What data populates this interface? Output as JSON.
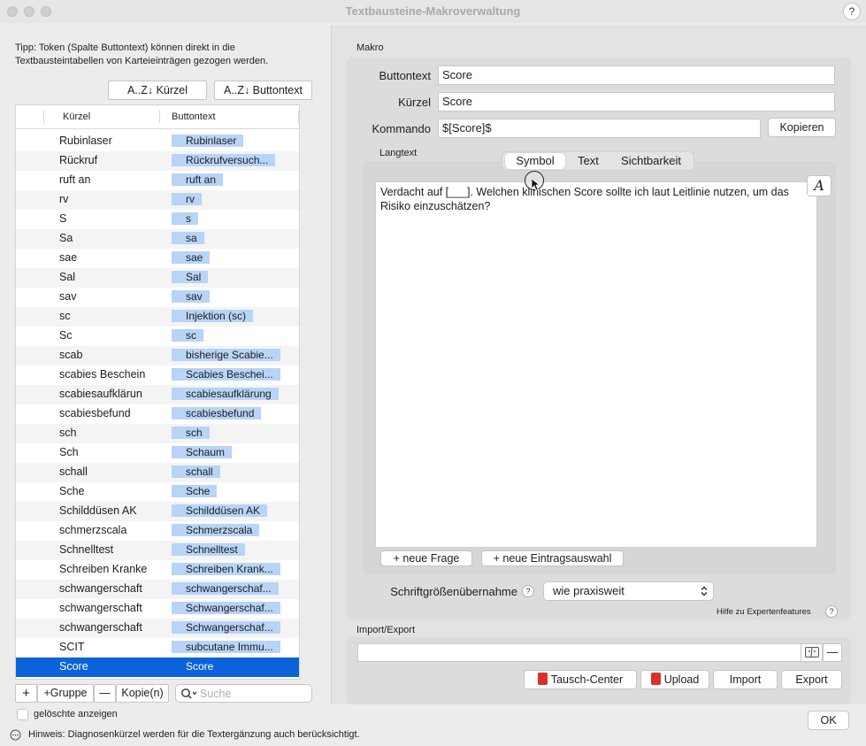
{
  "window": {
    "title": "Textbausteine-Makroverwaltung",
    "help": "?"
  },
  "left": {
    "tip": "Tipp: Token (Spalte Buttontext) können direkt in die Textbausteintabellen von Karteieinträgen gezogen werden.",
    "sort_kuerzel": "A..Z↓ Kürzel",
    "sort_buttontext": "A..Z↓ Buttontext",
    "table": {
      "col_kuerzel": "Kürzel",
      "col_buttontext": "Buttontext",
      "rows": [
        {
          "k": "Rubinlaser",
          "b": "Rubinlaser"
        },
        {
          "k": "Rückruf",
          "b": "Rückrufversuch..."
        },
        {
          "k": "ruft an",
          "b": "ruft an"
        },
        {
          "k": "rv",
          "b": "rv"
        },
        {
          "k": "S",
          "b": "s"
        },
        {
          "k": "Sa",
          "b": "sa"
        },
        {
          "k": "sae",
          "b": "sae"
        },
        {
          "k": "Sal",
          "b": "Sal"
        },
        {
          "k": "sav",
          "b": "sav"
        },
        {
          "k": "sc",
          "b": "Injektion (sc)"
        },
        {
          "k": "Sc",
          "b": "sc"
        },
        {
          "k": "scab",
          "b": "bisherige Scabie..."
        },
        {
          "k": "scabies Beschein",
          "b": "Scabies Beschei..."
        },
        {
          "k": "scabiesaufklärun",
          "b": "scabiesaufklärung"
        },
        {
          "k": "scabiesbefund",
          "b": "scabiesbefund"
        },
        {
          "k": "sch",
          "b": "sch"
        },
        {
          "k": "Sch",
          "b": "Schaum"
        },
        {
          "k": "schall",
          "b": "schall"
        },
        {
          "k": "Sche",
          "b": "Sche"
        },
        {
          "k": "Schilddüsen AK",
          "b": "Schilddüsen AK"
        },
        {
          "k": "schmerzscala",
          "b": "Schmerzscala"
        },
        {
          "k": "Schnelltest",
          "b": "Schnelltest"
        },
        {
          "k": "Schreiben Kranke",
          "b": "Schreiben Krank..."
        },
        {
          "k": "schwangerschaft",
          "b": "schwangerschaf..."
        },
        {
          "k": "schwangerschaft",
          "b": "Schwangerschaf..."
        },
        {
          "k": "schwangerschaft",
          "b": "Schwangerschaf..."
        },
        {
          "k": "SCIT",
          "b": "subcutane Immu..."
        },
        {
          "k": "Score",
          "b": "Score"
        }
      ]
    },
    "add": "+",
    "add_group": "+Gruppe",
    "remove": "—",
    "copy": "Kopie(n)",
    "search_placeholder": "Suche",
    "show_deleted": "gelöschte anzeigen"
  },
  "macro": {
    "section": "Makro",
    "buttontext_label": "Buttontext",
    "buttontext_value": "Score",
    "kuerzel_label": "Kürzel",
    "kuerzel_value": "Score",
    "kommando_label": "Kommando",
    "kommando_value": "$[Score]$",
    "kopieren": "Kopieren",
    "langtext_label": "Langtext",
    "tabs": [
      "Symbol",
      "Text",
      "Sichtbarkeit"
    ],
    "font_button": "A",
    "langtext_value": "Verdacht auf [___]. Welchen klinischen Score sollte ich laut Leitlinie nutzen, um das Risiko einzuschätzen?",
    "neue_frage": "+ neue Frage",
    "neue_eintragsauswahl": "+ neue Eintragsauswahl",
    "schrift_label": "Schriftgrößenübernahme",
    "schrift_value": "wie praxisweit",
    "hilfe": "Hilfe zu Expertenfeatures",
    "q": "?"
  },
  "io": {
    "section": "Import/Export",
    "tausch": "Tausch-Center",
    "upload": "Upload",
    "import": "Import",
    "export": "Export",
    "remove": "—"
  },
  "ok": "OK",
  "footer": "Hinweis: Diagnosenkürzel werden für die Textergänzung auch berücksichtigt."
}
